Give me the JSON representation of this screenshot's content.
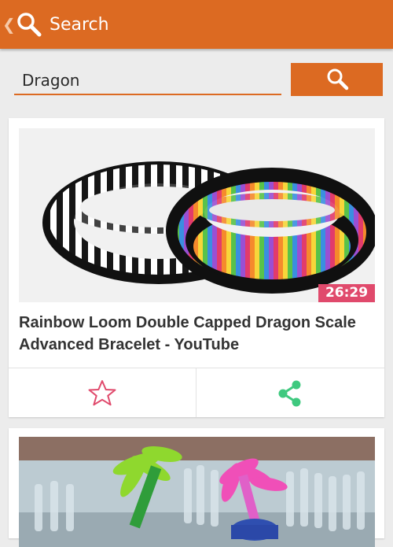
{
  "app_bar": {
    "back_icon": "chevron-left-icon",
    "search_icon": "search-icon",
    "title": "Search",
    "background_color": "#dc6a22"
  },
  "search": {
    "query": "Dragon",
    "button_icon": "search-icon"
  },
  "results": [
    {
      "thumbnail": "rainbow-loom-bracelets-image",
      "duration": "26:29",
      "title": "Rainbow Loom Double Capped Dragon Scale Advanced Bracelet - YouTube",
      "actions": [
        {
          "name": "favorite",
          "icon": "star-outline-icon",
          "color": "#e04a6c"
        },
        {
          "name": "share",
          "icon": "share-icon",
          "color": "#3fc97f"
        }
      ]
    },
    {
      "thumbnail": "loom-palm-tree-charms-image"
    }
  ],
  "colors": {
    "accent": "#dc6a22",
    "duration_badge": "#e04a6c",
    "share": "#3fc97f",
    "background": "#ececec"
  }
}
